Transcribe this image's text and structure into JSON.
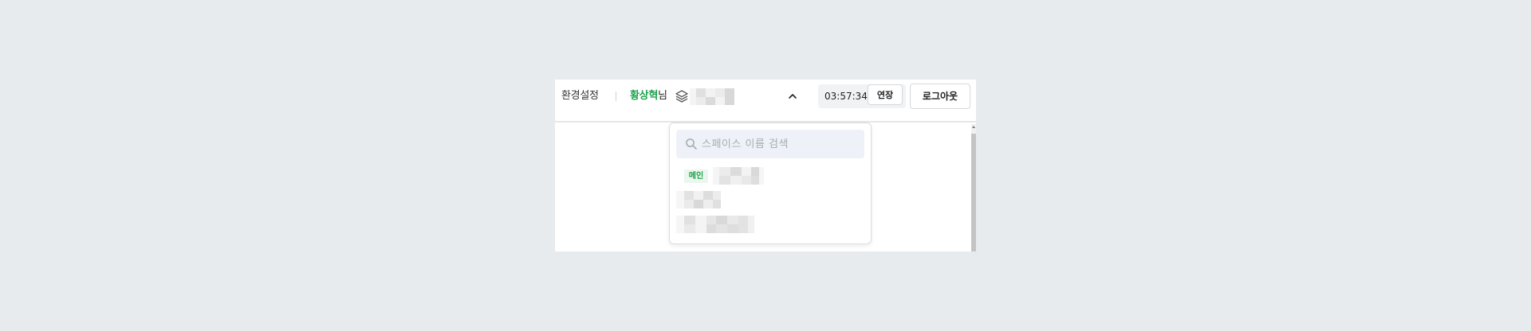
{
  "header": {
    "settings_label": "환경설정",
    "user_name": "황상혁",
    "user_suffix": "님",
    "current_space_icon": "layers-icon",
    "dropdown_toggle_icon": "chevron-up-icon",
    "session_timer": "03:57:34",
    "extend_label": "연장",
    "logout_label": "로그아웃"
  },
  "space_dropdown": {
    "search": {
      "placeholder": "스페이스 이름 검색",
      "value": "",
      "icon": "search-icon"
    },
    "items": [
      {
        "badge": "메인"
      },
      {
        "badge": ""
      },
      {
        "badge": ""
      }
    ]
  },
  "colors": {
    "accent_green": "#1aa34a",
    "badge_bg": "#eaf6ee",
    "search_bg": "#eef2f8",
    "page_bg": "#e7ebee"
  }
}
